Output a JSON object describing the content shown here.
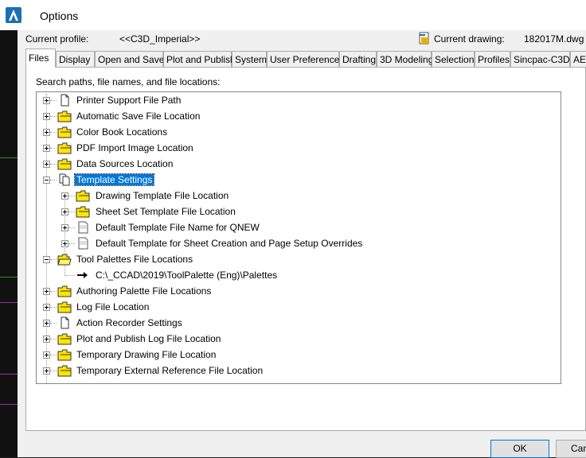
{
  "window": {
    "title": "Options"
  },
  "profile": {
    "label": "Current profile:",
    "value": "<<C3D_Imperial>>",
    "drawing_label": "Current drawing:",
    "drawing_value": "182017M.dwg"
  },
  "tabs": [
    {
      "label": "Files"
    },
    {
      "label": "Display"
    },
    {
      "label": "Open and Save"
    },
    {
      "label": "Plot and Publish"
    },
    {
      "label": "System"
    },
    {
      "label": "User Preferences"
    },
    {
      "label": "Drafting"
    },
    {
      "label": "3D Modeling"
    },
    {
      "label": "Selection"
    },
    {
      "label": "Profiles"
    },
    {
      "label": "Sincpac-C3D"
    },
    {
      "label": "AEC"
    }
  ],
  "panel": {
    "heading": "Search paths, file names, and file locations:"
  },
  "tree": [
    {
      "label": "Printer Support File Path",
      "icon": "page-icon"
    },
    {
      "label": "Automatic Save File Location",
      "icon": "folder-icon"
    },
    {
      "label": "Color Book Locations",
      "icon": "folder-icon"
    },
    {
      "label": "PDF Import Image Location",
      "icon": "folder-icon"
    },
    {
      "label": "Data Sources Location",
      "icon": "folder-icon"
    },
    {
      "label": "Template Settings",
      "icon": "pages-icon",
      "selected": true
    },
    {
      "label": "Drawing Template File Location",
      "icon": "folder-icon"
    },
    {
      "label": "Sheet Set Template File Location",
      "icon": "folder-icon"
    },
    {
      "label": "Default Template File Name for QNEW",
      "icon": "dwg-file-icon"
    },
    {
      "label": "Default Template for Sheet Creation and Page Setup Overrides",
      "icon": "dwg-file-icon"
    },
    {
      "label": "Tool Palettes File Locations",
      "icon": "folder-open-icon"
    },
    {
      "label": "C:\\_CCAD\\2019\\ToolPalette (Eng)\\Palettes",
      "icon": "path-arrow-icon"
    },
    {
      "label": "Authoring Palette File Locations",
      "icon": "folder-icon"
    },
    {
      "label": "Log File Location",
      "icon": "folder-icon"
    },
    {
      "label": "Action Recorder Settings",
      "icon": "page-icon"
    },
    {
      "label": "Plot and Publish Log File Location",
      "icon": "folder-icon"
    },
    {
      "label": "Temporary Drawing File Location",
      "icon": "folder-icon"
    },
    {
      "label": "Temporary External Reference File Location",
      "icon": "folder-icon"
    }
  ],
  "buttons": {
    "ok": "OK",
    "cancel": "Cancel"
  },
  "colors": {
    "selection": "#0078d7",
    "folder": "#ffe600",
    "accent": "#1c6fb4"
  }
}
